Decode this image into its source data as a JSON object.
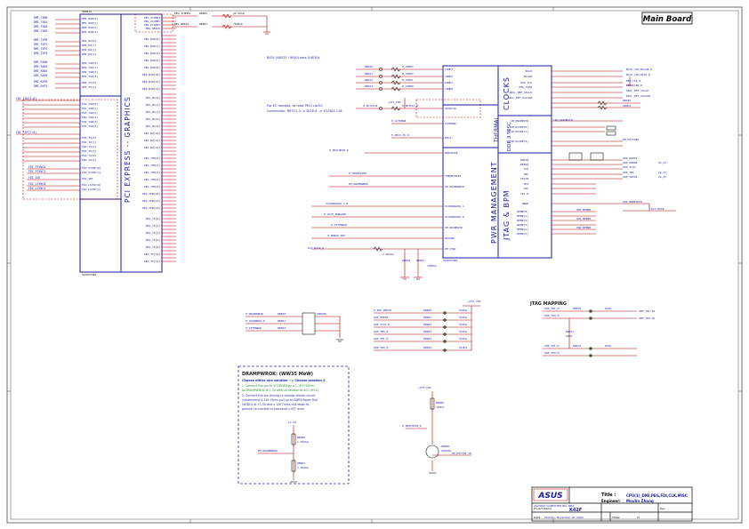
{
  "header": {
    "sheet_title": "Main Board"
  },
  "cpu_blocks": {
    "pcie_graphics": "PCI EXPRESS -- GRAPHICS",
    "clocks": "CLOCKS",
    "thermal": "THERMAL",
    "ddr3_misc": "DDR 3 MISC",
    "pwr_management": "PWR MANAGEMENT",
    "jtag_bpm": "JTAG & BPM"
  },
  "notes": {
    "peci_note_1": "BIOS (Y8037 / IRQ0) sets (U8/30)",
    "peci_note_2": "For EC request, to read PECI via EC",
    "peci_note_3": "Connection: RR371,3 -> DG301 -> U1/303 118",
    "jtag_mapping": "JTAG MAPPING",
    "dramp_title": "DRAMPWROK: (WW35 MoW)",
    "dramp_line1": "Choose either one solution --> Choose solution 2",
    "dramp_line2": "1. Connect this pin to VCCDDR3 by a 1.1K+75Ohm",
    "dramp_line3": "   to DRAMPWROK at 1.5V with 1K resistor to VCC (HV4)",
    "dramp_line4": "2. Connect this pin through a voltage divider circuit",
    "dramp_line5": "   (recommend 4.12K Ohms pull-up to DDR3 Power Rail",
    "dramp_line6": "   (VDDQ) of +1.5V and a 12K Ohms pull-down to",
    "dramp_line7": "   ground) to connect to processor's VTT rever"
  },
  "title_block": {
    "company": "ASUS",
    "company_line": "ASUSTeK COMPUTER INC.  NB1",
    "title_label": "Title :",
    "title_value": "CPU(1)_DMI,PEG,FDI,CLK,MISC",
    "engineer_label": "Engineer:",
    "engineer_value": "Moulin Zhang",
    "project_label": "Project Name",
    "project_value": "K42F",
    "rev_label": "Rev",
    "date_label": "Date:",
    "date_value": "Monday, November 16, 2009",
    "sheet_label": "Sheet",
    "of_label": "of"
  },
  "colors": {
    "frame": "#4a4a4a",
    "block": "#1a1aa0",
    "wire": "#b00000",
    "label": "#2222aa",
    "part": "#1a1a1a",
    "note_box": "#2a2aa0",
    "note_highlight": "#2a8a2a"
  }
}
